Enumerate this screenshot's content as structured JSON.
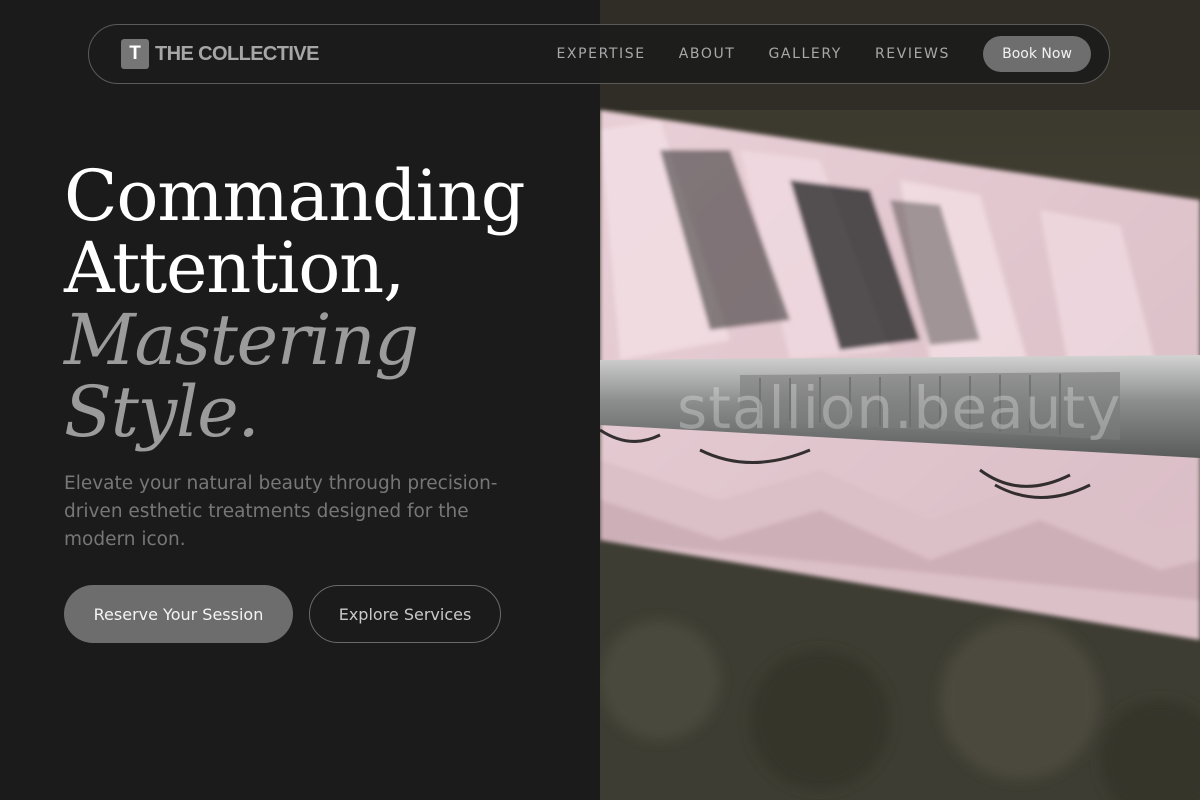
{
  "brand": {
    "mark": "T",
    "name": "THE COLLECTIVE"
  },
  "nav": {
    "links": [
      "EXPERTISE",
      "ABOUT",
      "GALLERY",
      "REVIEWS"
    ],
    "cta_label": "Book Now"
  },
  "hero": {
    "headline_line1": "Commanding",
    "headline_line2": "Attention,",
    "headline_italic_line1": "Mastering",
    "headline_italic_line2": "Style.",
    "subtitle": "Elevate your natural beauty through precision-driven esthetic treatments designed for the modern icon.",
    "primary_button_label": "Reserve Your Session",
    "secondary_button_label": "Explore Services"
  },
  "image": {
    "watermark": "stallion.beauty"
  },
  "colors": {
    "background": "#1b1b1b",
    "accent_button": "#6d6d6d",
    "italic_text": "#9b9b9b",
    "lash_tray_pink": "#e3c8cf"
  }
}
